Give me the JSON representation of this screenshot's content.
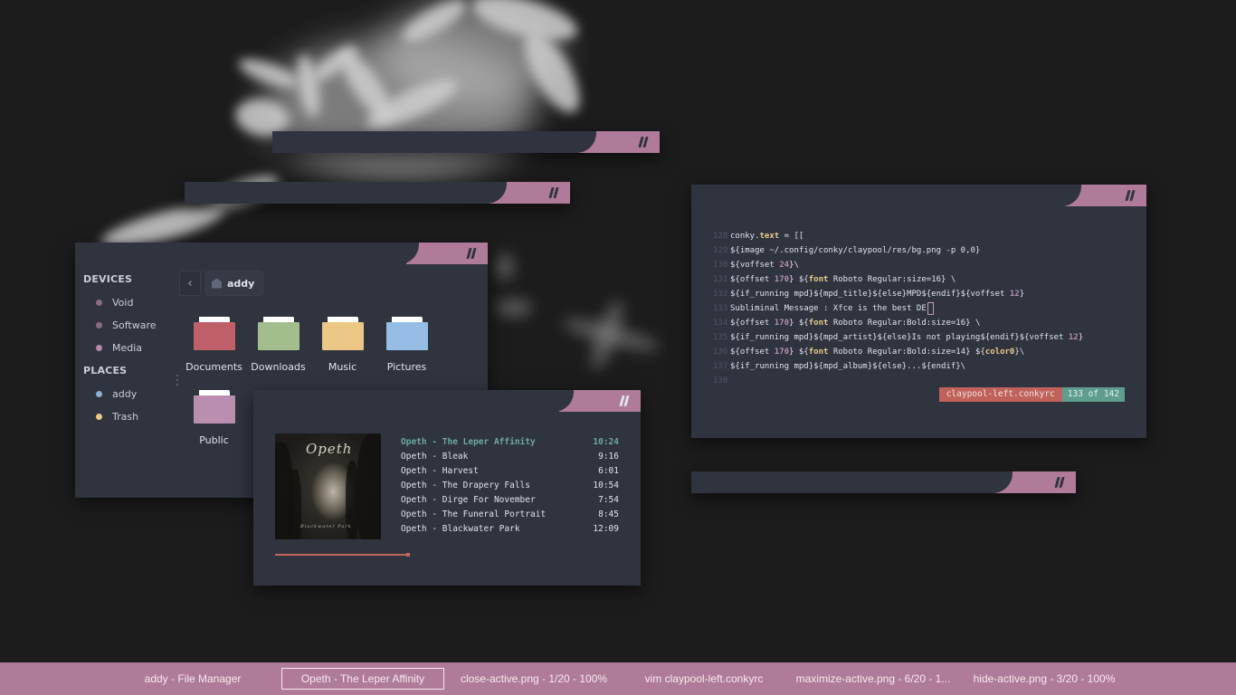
{
  "colors": {
    "window_bg": "#2f343f",
    "accent_pink": "#b07b98",
    "accent_green": "#6fa89a",
    "accent_red": "#c0625a",
    "text": "#dfe3ea"
  },
  "file_manager": {
    "devices_header": "DEVICES",
    "devices": [
      {
        "label": "Void",
        "dot_color": "#8c6b82"
      },
      {
        "label": "Software",
        "dot_color": "#8c6b82"
      },
      {
        "label": "Media",
        "dot_color": "#b88aa8"
      }
    ],
    "places_header": "PLACES",
    "places": [
      {
        "label": "addy",
        "dot_color": "#8eaed3"
      },
      {
        "label": "Trash",
        "dot_color": "#ebc886"
      }
    ],
    "back_icon": "‹",
    "breadcrumb": "addy",
    "folders": [
      {
        "name": "Documents",
        "color": "#bf6068"
      },
      {
        "name": "Downloads",
        "color": "#a3be8c"
      },
      {
        "name": "Music",
        "color": "#ebc886"
      },
      {
        "name": "Pictures",
        "color": "#96bde6"
      },
      {
        "name": "Public",
        "color": "#b98eae"
      }
    ]
  },
  "music_player": {
    "album_logo": "Opeth",
    "album_subtitle": "Blackwater Park",
    "tracks": [
      {
        "title": "Opeth - The Leper Affinity",
        "duration": "10:24",
        "active": true
      },
      {
        "title": "Opeth - Bleak",
        "duration": "9:16"
      },
      {
        "title": "Opeth - Harvest",
        "duration": "6:01"
      },
      {
        "title": "Opeth - The Drapery Falls",
        "duration": "10:54"
      },
      {
        "title": "Opeth - Dirge For November",
        "duration": "7:54"
      },
      {
        "title": "Opeth - The Funeral Portrait",
        "duration": "8:45"
      },
      {
        "title": "Opeth - Blackwater Park",
        "duration": "12:09"
      }
    ],
    "progress_fraction": 0.6
  },
  "editor": {
    "lines": [
      {
        "num": "128",
        "parts": [
          [
            "t",
            "conky."
          ],
          [
            "k",
            "text"
          ],
          [
            "t",
            " = [["
          ]
        ]
      },
      {
        "num": "129",
        "parts": [
          [
            "t",
            "${image ~/.config/conky/claypool/res/bg.png -p 0,0}"
          ]
        ]
      },
      {
        "num": "130",
        "parts": [
          [
            "t",
            "${voffset "
          ],
          [
            "n",
            "24"
          ],
          [
            "t",
            "}\\"
          ]
        ]
      },
      {
        "num": "131",
        "parts": [
          [
            "t",
            "${offset "
          ],
          [
            "n",
            "170"
          ],
          [
            "t",
            "} ${"
          ],
          [
            "k",
            "font"
          ],
          [
            "t",
            " Roboto Regular:size=16} \\"
          ]
        ]
      },
      {
        "num": "132",
        "parts": [
          [
            "t",
            "${if_running mpd}${mpd_title}${else}MPD${endif}${voffset "
          ],
          [
            "n",
            "12"
          ],
          [
            "t",
            "}"
          ]
        ]
      },
      {
        "num": "133",
        "parts": [
          [
            "t",
            "Subliminal Message : Xfce is the best DE"
          ],
          [
            "c",
            ""
          ]
        ]
      },
      {
        "num": "134",
        "parts": [
          [
            "t",
            "${offset "
          ],
          [
            "n",
            "170"
          ],
          [
            "t",
            "} ${"
          ],
          [
            "k",
            "font"
          ],
          [
            "t",
            " Roboto Regular:Bold:size=16} \\"
          ]
        ]
      },
      {
        "num": "135",
        "parts": [
          [
            "t",
            "${if_running mpd}${mpd_artist}${else}Is not playing${endif}${voffset "
          ],
          [
            "n",
            "12"
          ],
          [
            "t",
            "}"
          ]
        ]
      },
      {
        "num": "136",
        "parts": [
          [
            "t",
            "${offset "
          ],
          [
            "n",
            "170"
          ],
          [
            "t",
            "} ${"
          ],
          [
            "k",
            "font"
          ],
          [
            "t",
            " Roboto Regular:Bold:size=14} ${"
          ],
          [
            "k",
            "color0"
          ],
          [
            "t",
            "}\\"
          ]
        ]
      },
      {
        "num": "137",
        "parts": [
          [
            "t",
            "${if_running mpd}${mpd_album}${else}...${endif}\\"
          ]
        ]
      },
      {
        "num": "138",
        "parts": []
      }
    ],
    "status_file": "claypool-left.conkyrc",
    "status_pos": "133 of 142"
  },
  "taskbar": {
    "tasks": [
      {
        "label": "addy - File Manager"
      },
      {
        "label": "Opeth - The Leper Affinity",
        "active": true
      },
      {
        "label": "close-active.png - 1/20 - 100%"
      },
      {
        "label": "vim claypool-left.conkyrc"
      },
      {
        "label": "maximize-active.png - 6/20 - 1..."
      },
      {
        "label": "hide-active.png - 3/20 - 100%"
      }
    ]
  }
}
